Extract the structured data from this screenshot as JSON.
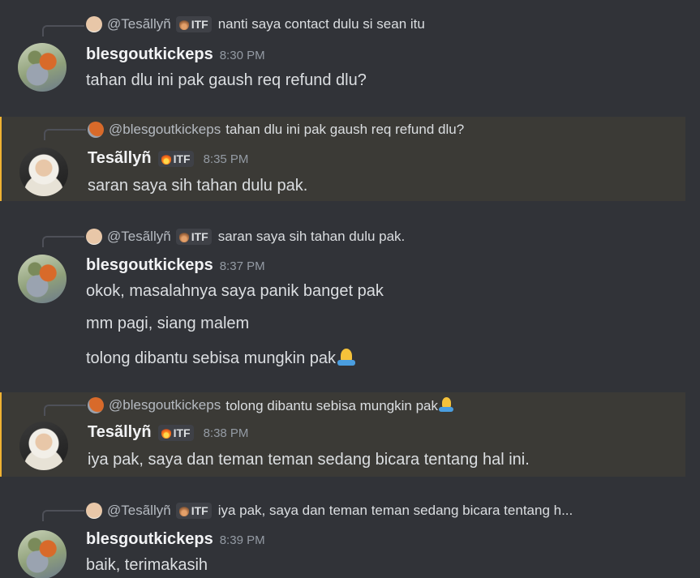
{
  "messages": [
    {
      "reply": {
        "name": "@Tesãllyñ",
        "tag": "ITF",
        "text": "nanti saya contact dulu si sean itu"
      },
      "author": "blesgoutkickeps",
      "time": "8:30 PM",
      "lines": [
        "tahan dlu ini pak gaush req refund dlu?"
      ]
    },
    {
      "reply": {
        "name": "@blesgoutkickeps",
        "text": "tahan dlu ini pak gaush req refund dlu?"
      },
      "author": "Tesãllyñ",
      "tag": "ITF",
      "time": "8:35 PM",
      "lines": [
        "saran saya sih tahan dulu pak."
      ]
    },
    {
      "reply": {
        "name": "@Tesãllyñ",
        "tag": "ITF",
        "text": "saran saya sih tahan dulu pak."
      },
      "author": "blesgoutkickeps",
      "time": "8:37 PM",
      "lines": [
        "okok, masalahnya saya panik banget pak",
        "mm pagi, siang malem",
        "tolong dibantu sebisa mungkin pak"
      ]
    },
    {
      "reply": {
        "name": "@blesgoutkickeps",
        "text": "tolong dibantu sebisa mungkin pak"
      },
      "author": "Tesãllyñ",
      "tag": "ITF",
      "time": "8:38 PM",
      "lines": [
        "iya pak, saya dan teman teman sedang bicara tentang hal ini."
      ]
    },
    {
      "reply": {
        "name": "@Tesãllyñ",
        "tag": "ITF",
        "text": "iya pak, saya dan teman teman sedang bicara tentang h..."
      },
      "author": "blesgoutkickeps",
      "time": "8:39 PM",
      "lines": [
        "baik, terimakasih"
      ]
    }
  ],
  "icons": {
    "role_tag": "flame-icon",
    "emoji": "folded-hands-emoji"
  },
  "colors": {
    "background": "#313338",
    "highlight": "#3b3a36",
    "highlight_border": "#f0b232"
  }
}
